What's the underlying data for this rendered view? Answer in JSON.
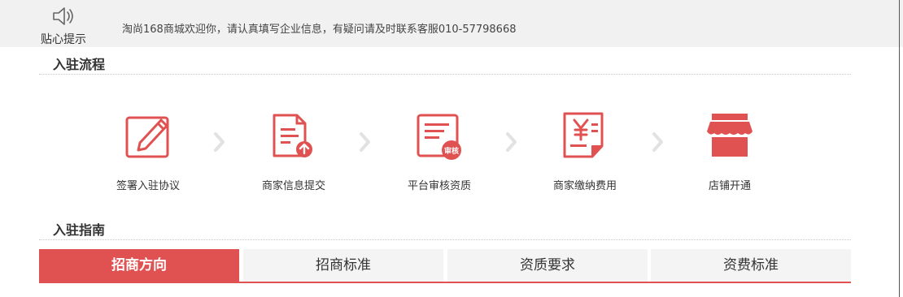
{
  "notice": {
    "label": "贴心提示",
    "message": "淘尚168商城欢迎你，请认真填写企业信息，有疑问请及时联系客服010-57798668",
    "icon": "speaker-icon"
  },
  "process": {
    "title": "入驻流程",
    "steps": [
      {
        "label": "签署入驻协议",
        "icon": "edit-icon"
      },
      {
        "label": "商家信息提交",
        "icon": "document-upload-icon"
      },
      {
        "label": "平台审核资质",
        "icon": "review-icon",
        "badge": "审核"
      },
      {
        "label": "商家缴纳费用",
        "icon": "yuan-receipt-icon"
      },
      {
        "label": "店铺开通",
        "icon": "store-icon"
      }
    ],
    "separator_icon": "chevron-right-icon"
  },
  "guide": {
    "title": "入驻指南",
    "tabs": [
      {
        "label": "招商方向",
        "active": true
      },
      {
        "label": "招商标准",
        "active": false
      },
      {
        "label": "资质要求",
        "active": false
      },
      {
        "label": "资费标准",
        "active": false
      }
    ]
  },
  "colors": {
    "accent": "#e05252",
    "notice_bg": "#f1f1f1",
    "tab_bg": "#f4f4f4",
    "chevron": "#e2e2e2"
  }
}
